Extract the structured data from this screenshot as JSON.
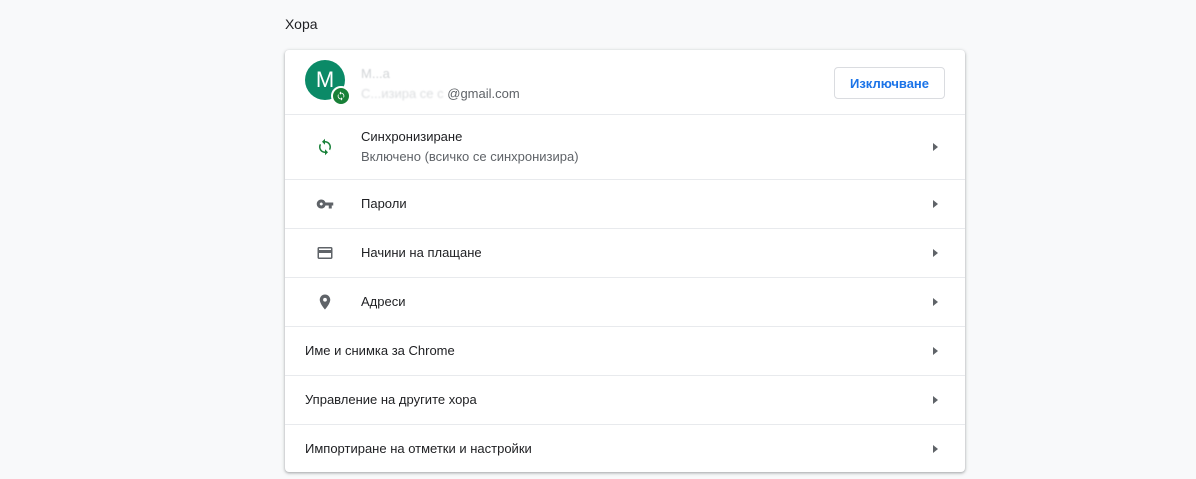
{
  "section": {
    "title": "Хора"
  },
  "profile": {
    "avatar_letter": "M",
    "name": "M...a",
    "sync_prefix": "С...изира се с",
    "email_suffix": "@gmail.com",
    "signout_label": "Изключване",
    "avatar_color": "#0b8a67"
  },
  "rows": [
    {
      "label": "Синхронизиране",
      "sub": "Включено (всичко се синхронизира)",
      "icon": "sync-icon"
    },
    {
      "label": "Пароли",
      "icon": "key-icon"
    },
    {
      "label": "Начини на плащане",
      "icon": "credit-card-icon"
    },
    {
      "label": "Адреси",
      "icon": "location-pin-icon"
    },
    {
      "label": "Име и снимка за Chrome"
    },
    {
      "label": "Управление на другите хора"
    },
    {
      "label": "Импортиране на отметки и настройки"
    }
  ],
  "colors": {
    "accent": "#1a73e8",
    "sync_green": "#188038",
    "icon_gray": "#5f6368"
  }
}
